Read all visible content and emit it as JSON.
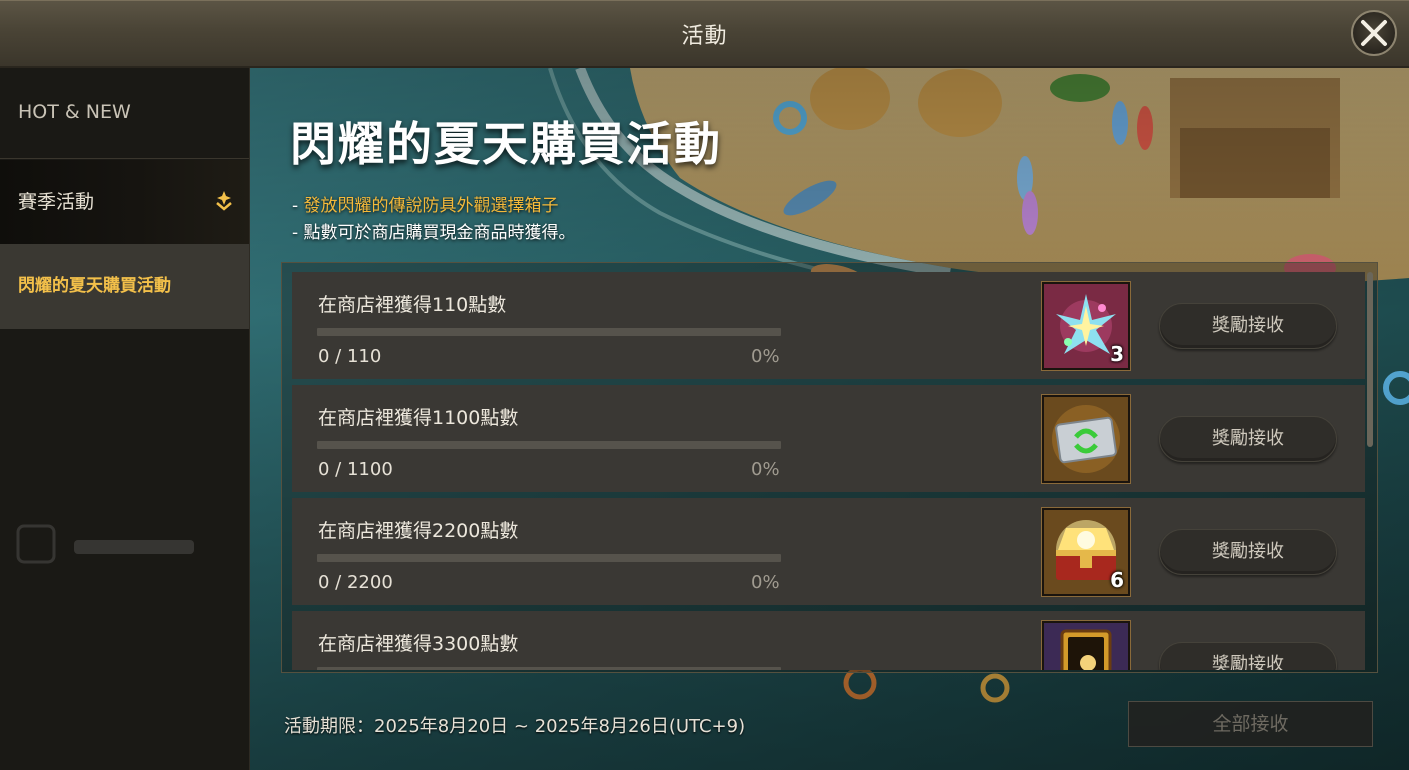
{
  "window": {
    "title": "活動"
  },
  "sidebar": {
    "hot_new": "HOT & NEW",
    "season_label": "賽季活動",
    "active_item": "閃耀的夏天購買活動"
  },
  "event": {
    "title": "閃耀的夏天購買活動",
    "desc_prefix": "- ",
    "desc1_highlight": "發放閃耀的傳說防具外觀選擇箱子",
    "desc2": "- 點數可於商店購買現金商品時獲得。"
  },
  "missions": [
    {
      "label": "在商店裡獲得110點數",
      "count": "0 / 110",
      "pct": "0%",
      "progress": 0,
      "reward_icon": "crystal-shard-icon",
      "reward_qty": "3",
      "claim": "獎勵接收"
    },
    {
      "label": "在商店裡獲得1100點數",
      "count": "0 / 1100",
      "pct": "0%",
      "progress": 0,
      "reward_icon": "exchange-ticket-icon",
      "reward_qty": "",
      "claim": "獎勵接收"
    },
    {
      "label": "在商店裡獲得2200點數",
      "count": "0 / 2200",
      "pct": "0%",
      "progress": 0,
      "reward_icon": "treasure-chest-icon",
      "reward_qty": "6",
      "claim": "獎勵接收"
    },
    {
      "label": "在商店裡獲得3300點數",
      "count": "",
      "pct": "",
      "progress": 0,
      "reward_icon": "card-icon",
      "reward_qty": "",
      "claim": "獎勵接收"
    }
  ],
  "footer": {
    "period": "活動期限：2025年8月20日 ~ 2025年8月26日(UTC+9)",
    "claim_all": "全部接收"
  },
  "colors": {
    "accent_gold": "#f3c04a",
    "highlight_orange": "#f4b93a"
  }
}
